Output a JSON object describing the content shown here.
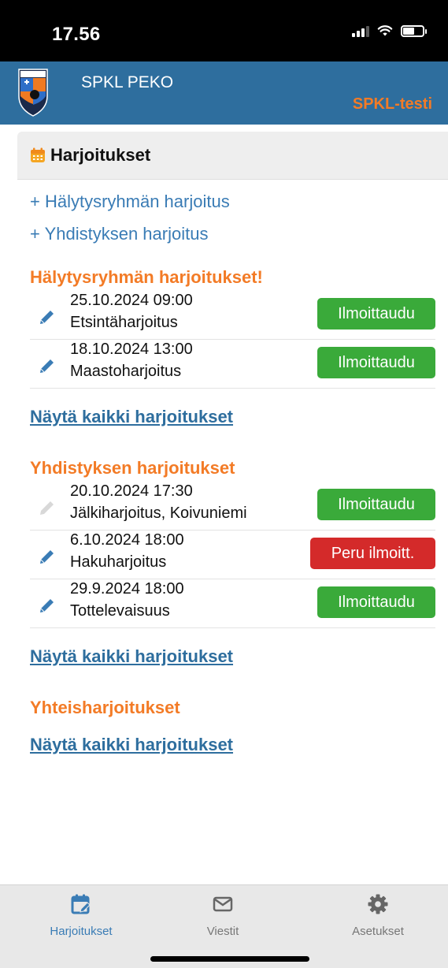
{
  "status_bar": {
    "time": "17.56"
  },
  "header": {
    "app_name": "SPKL PEKO",
    "environment": "SPKL-testi"
  },
  "page": {
    "title": "Harjoitukset"
  },
  "add_links": [
    {
      "label": "+ Hälytysryhmän harjoitus"
    },
    {
      "label": "+ Yhdistyksen harjoitus"
    }
  ],
  "sections": [
    {
      "title": "Hälytysryhmän harjoitukset!",
      "rows": [
        {
          "date": "25.10.2024 09:00",
          "name": "Etsintäharjoitus",
          "button": "Ilmoittaudu"
        },
        {
          "date": "18.10.2024 13:00",
          "name": "Maastoharjoitus",
          "button": "Ilmoittaudu"
        }
      ],
      "show_all": "Näytä kaikki harjoitukset"
    },
    {
      "title": "Yhdistyksen harjoitukset",
      "rows": [
        {
          "date": "20.10.2024 17:30",
          "name": "Jälkiharjoitus, Koivuniemi",
          "button": "Ilmoittaudu"
        },
        {
          "date": "6.10.2024 18:00",
          "name": "Hakuharjoitus",
          "button": "Peru ilmoitt."
        },
        {
          "date": "29.9.2024 18:00",
          "name": "Tottelevaisuus",
          "button": "Ilmoittaudu"
        }
      ],
      "show_all": "Näytä kaikki harjoitukset"
    },
    {
      "title": "Yhteisharjoitukset",
      "rows": [],
      "show_all": "Näytä kaikki harjoitukset"
    }
  ],
  "tabs": [
    {
      "label": "Harjoitukset",
      "icon": "calendar-edit-icon",
      "active": true
    },
    {
      "label": "Viestit",
      "icon": "envelope-icon",
      "active": false
    },
    {
      "label": "Asetukset",
      "icon": "gear-icon",
      "active": false
    }
  ],
  "colors": {
    "header_bg": "#2e6e9e",
    "accent_orange": "#f37b26",
    "link_blue": "#3a7cb5",
    "button_green": "#3aaa3a",
    "button_red": "#d42a2a"
  }
}
